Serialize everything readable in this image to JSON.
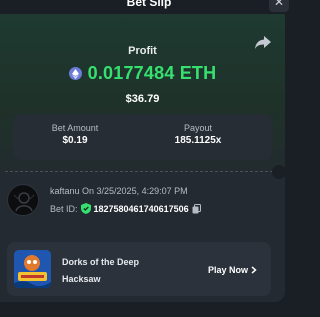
{
  "header": {
    "title": "Bet Slip",
    "close_icon": "close-icon"
  },
  "profit": {
    "label": "Profit",
    "value": "0.0177484 ETH",
    "usd": "$36.79",
    "currency_icon": "eth-icon",
    "color": "#36e06f"
  },
  "stats": {
    "bet_amount": {
      "label": "Bet Amount",
      "value": "$0.19"
    },
    "payout": {
      "label": "Payout",
      "value": "185.1125x"
    }
  },
  "bet": {
    "user_line": "kaftanu On 3/25/2025, 4:29:07 PM",
    "bet_id_label": "Bet ID:",
    "bet_id": "1827580461740617506"
  },
  "game": {
    "name": "Dorks of the Deep",
    "provider": "Hacksaw",
    "play_label": "Play Now"
  },
  "colors": {
    "accent_green": "#36e06f",
    "panel": "#242a32",
    "background": "#1a1f26"
  }
}
